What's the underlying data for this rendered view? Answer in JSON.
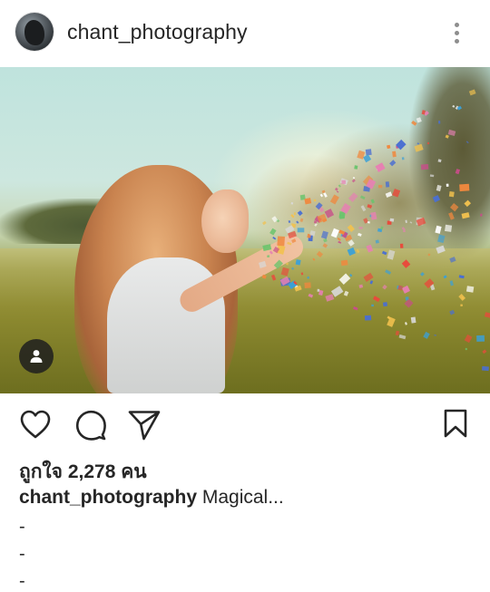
{
  "post": {
    "username": "chant_photography",
    "likes_text": "ถูกใจ 2,278 คน",
    "caption_user": "chant_photography",
    "caption_text": "Magical...",
    "caption_lines": [
      "-",
      "-",
      "-"
    ]
  },
  "icons": {
    "avatar": "profile-photo",
    "more": "vertical-dots-icon",
    "tag": "person-icon",
    "like": "heart-icon",
    "comment": "comment-bubble-icon",
    "share": "paper-plane-icon",
    "save": "bookmark-icon"
  },
  "colors": {
    "text": "#262626",
    "muted": "#8e8e8e",
    "background": "#ffffff"
  }
}
